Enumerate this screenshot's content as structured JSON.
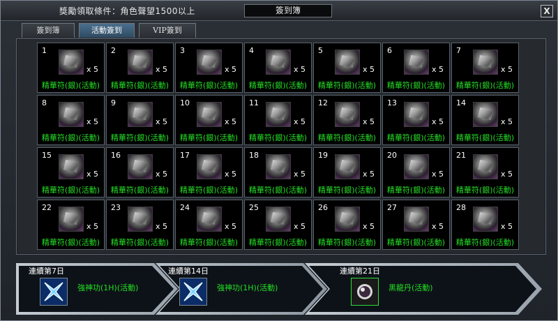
{
  "header": {
    "condition": "獎勵領取條件：角色聲望1500以上",
    "title": "簽到簿",
    "close_label": "X"
  },
  "tabs": [
    {
      "label": "簽到簿",
      "active": false
    },
    {
      "label": "活動簽到",
      "active": true
    },
    {
      "label": "VIP簽到",
      "active": false
    }
  ],
  "calendar": {
    "item_name": "精華符(銀)(活動)",
    "quantity": "x 5",
    "icon": "silver-talisman-icon",
    "days": [
      "1",
      "2",
      "3",
      "4",
      "5",
      "6",
      "7",
      "8",
      "9",
      "10",
      "11",
      "12",
      "13",
      "14",
      "15",
      "16",
      "17",
      "18",
      "19",
      "20",
      "21",
      "22",
      "23",
      "24",
      "25",
      "26",
      "27",
      "28"
    ]
  },
  "streak_rewards": [
    {
      "label": "連續第7日",
      "reward": "強神功(1H)(活動)",
      "icon": "blue-cross-blade-icon"
    },
    {
      "label": "連續第14日",
      "reward": "強神功(1H)(活動)",
      "icon": "blue-cross-blade-icon"
    },
    {
      "label": "連續第21日",
      "reward": "黑龍丹(活動)",
      "icon": "black-dragon-pill-icon"
    }
  ],
  "colors": {
    "item_name_green": "#26e026",
    "active_tab": "#3d5f7b",
    "band_gray": "#bfc6cd"
  }
}
